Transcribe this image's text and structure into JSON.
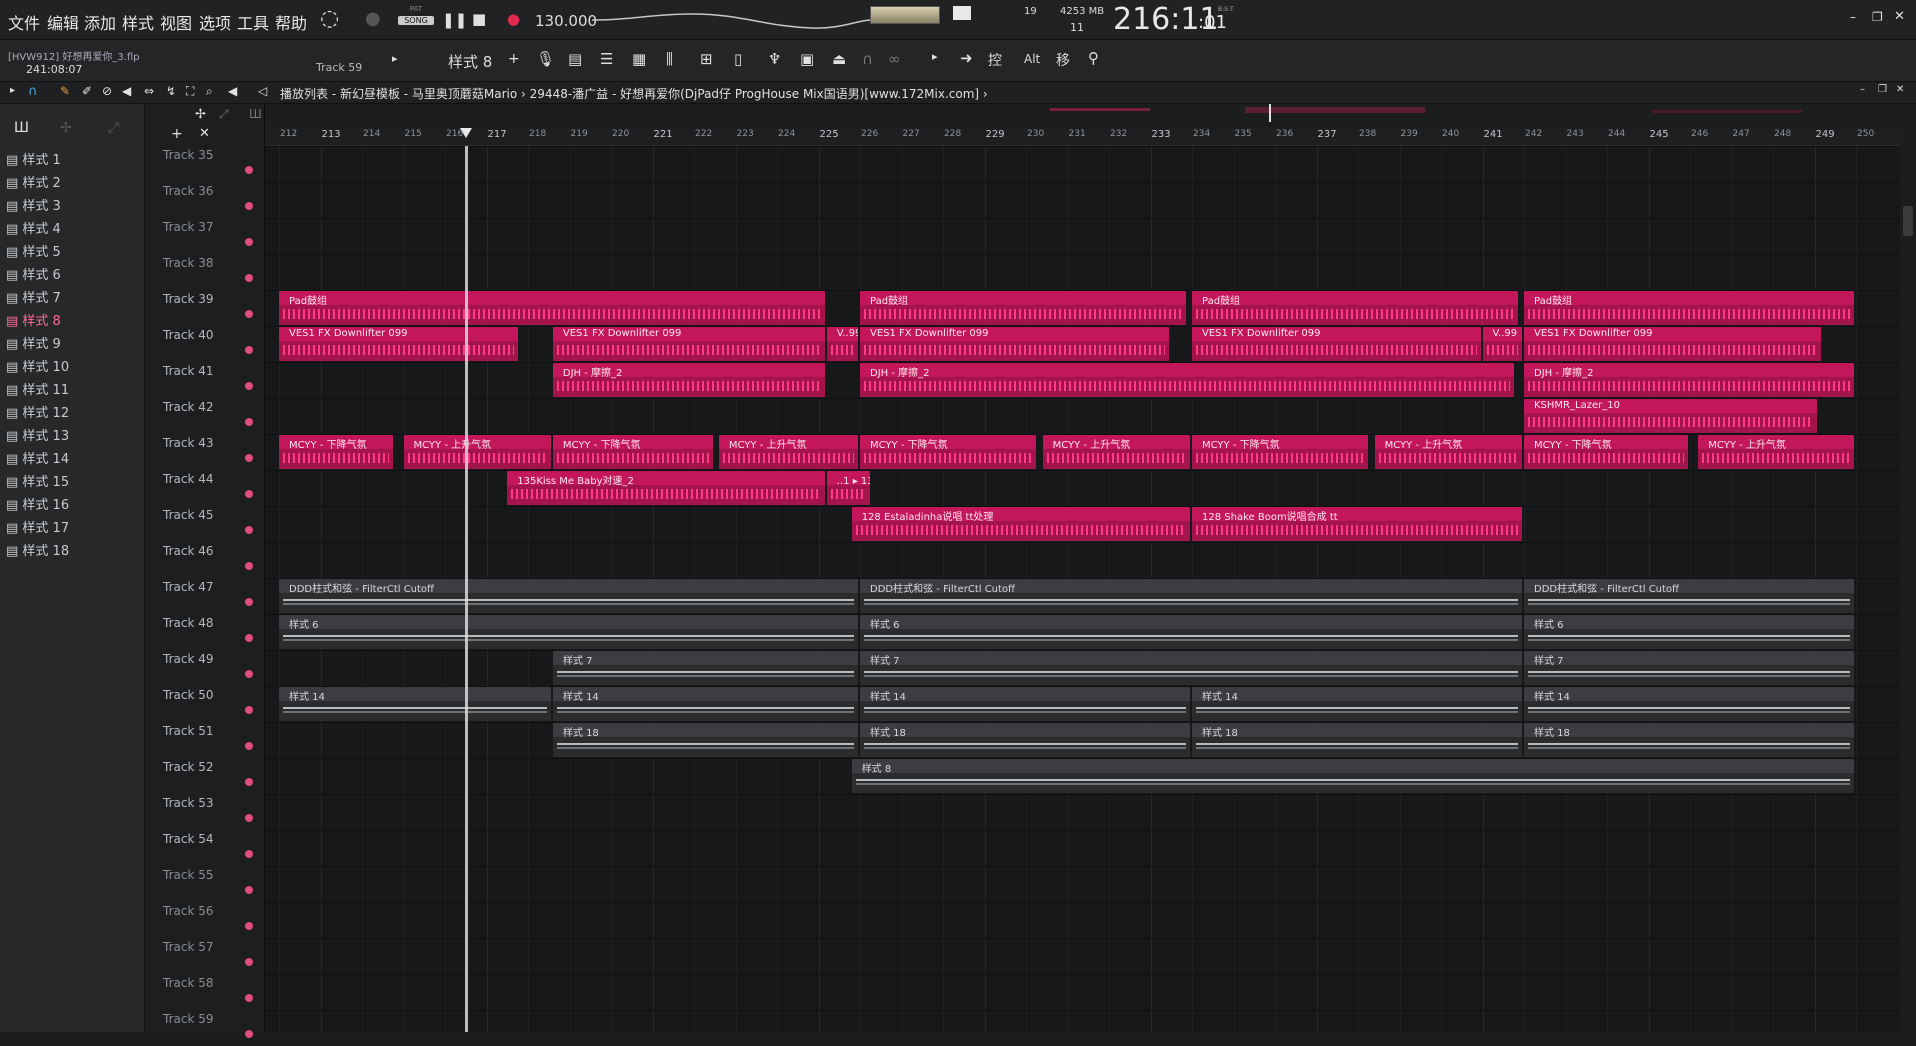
{
  "menu": [
    "文件",
    "编辑",
    "添加",
    "样式",
    "视图",
    "选项",
    "工具",
    "帮助"
  ],
  "transport": {
    "mode_top": "PAT",
    "mode_bottom": "SONG",
    "tempo": "130.000"
  },
  "meters": {
    "cpu": "19",
    "mem": "4253 MB",
    "poly": "11"
  },
  "time": {
    "main": "216:11",
    "sub": ":01",
    "unit": "B:S:T"
  },
  "project": {
    "file": "[HVW912] 好想再爱你_3.flp",
    "pos": "241:08:07"
  },
  "toolbar": {
    "track": "Track 59",
    "pattern": "样式 8",
    "letters": [
      "控",
      "Alt",
      "移"
    ]
  },
  "breadcrumb": "播放列表 - 新幻昼模板 - 马里奥顶蘑菇Mario › 29448-潘广益 - 好想再爱你(DjPad仔 ProgHouse Mix国语男)[www.172Mix.com] ›",
  "patterns": [
    "样式 1",
    "样式 2",
    "样式 3",
    "样式 4",
    "样式 5",
    "样式 6",
    "样式 7",
    "样式 8",
    "样式 9",
    "样式 10",
    "样式 11",
    "样式 12",
    "样式 13",
    "样式 14",
    "样式 15",
    "样式 16",
    "样式 17",
    "样式 18"
  ],
  "tracks": [
    "Track 35",
    "Track 36",
    "Track 37",
    "Track 38",
    "Track 39",
    "Track 40",
    "Track 41",
    "Track 42",
    "Track 43",
    "Track 44",
    "Track 45",
    "Track 46",
    "Track 47",
    "Track 48",
    "Track 49",
    "Track 50",
    "Track 51",
    "Track 52",
    "Track 53",
    "Track 54",
    "Track 55",
    "Track 56",
    "Track 57",
    "Track 58",
    "Track 59"
  ],
  "bars": [
    "212",
    "213",
    "214",
    "215",
    "216",
    "217",
    "218",
    "219",
    "220",
    "221",
    "222",
    "223",
    "224",
    "225",
    "226",
    "227",
    "228",
    "229",
    "230",
    "231",
    "232",
    "233",
    "234",
    "235",
    "236",
    "237",
    "238",
    "239",
    "240",
    "241",
    "242",
    "243",
    "244",
    "245",
    "246",
    "247",
    "248",
    "249",
    "250"
  ],
  "clips": [
    {
      "t": 4,
      "s": 212,
      "e": 225.2,
      "c": "pink",
      "label": "Pad鼓组"
    },
    {
      "t": 4,
      "s": 226,
      "e": 233.9,
      "c": "pink",
      "label": "Pad鼓组"
    },
    {
      "t": 4,
      "s": 234,
      "e": 241.9,
      "c": "pink",
      "label": "Pad鼓组"
    },
    {
      "t": 4,
      "s": 242,
      "e": 250,
      "c": "pink",
      "label": "Pad鼓组"
    },
    {
      "t": 5,
      "s": 212,
      "e": 217.8,
      "c": "pink",
      "label": "VES1 FX Downlifter 099"
    },
    {
      "t": 5,
      "s": 218.6,
      "e": 225.2,
      "c": "pink",
      "label": "VES1 FX Downlifter 099"
    },
    {
      "t": 5,
      "s": 225.2,
      "e": 226,
      "c": "pink",
      "label": "V..99"
    },
    {
      "t": 5,
      "s": 226,
      "e": 233.5,
      "c": "pink",
      "label": "VES1 FX Downlifter 099"
    },
    {
      "t": 5,
      "s": 234,
      "e": 241,
      "c": "pink",
      "label": "VES1 FX Downlifter 099"
    },
    {
      "t": 5,
      "s": 241,
      "e": 242,
      "c": "pink",
      "label": "V..99"
    },
    {
      "t": 5,
      "s": 242,
      "e": 249.2,
      "c": "pink",
      "label": "VES1 FX Downlifter 099"
    },
    {
      "t": 6,
      "s": 218.6,
      "e": 225.2,
      "c": "pink",
      "label": "DJH - 摩擦_2"
    },
    {
      "t": 6,
      "s": 226,
      "e": 241.8,
      "c": "pink",
      "label": "DJH - 摩擦_2"
    },
    {
      "t": 6,
      "s": 242,
      "e": 250,
      "c": "pink",
      "label": "DJH - 摩擦_2"
    },
    {
      "t": 7,
      "s": 242,
      "e": 249.1,
      "c": "pink",
      "label": "KSHMR_Lazer_10"
    },
    {
      "t": 8,
      "s": 212,
      "e": 214.8,
      "c": "pink",
      "label": "MCYY - 下降气氛"
    },
    {
      "t": 8,
      "s": 215,
      "e": 218.6,
      "c": "pink",
      "label": "MCYY - 上升气氛"
    },
    {
      "t": 8,
      "s": 218.6,
      "e": 222.5,
      "c": "pink",
      "label": "MCYY - 下降气氛"
    },
    {
      "t": 8,
      "s": 222.6,
      "e": 226,
      "c": "pink",
      "label": "MCYY - 上升气氛"
    },
    {
      "t": 8,
      "s": 226,
      "e": 230.3,
      "c": "pink",
      "label": "MCYY - 下降气氛"
    },
    {
      "t": 8,
      "s": 230.4,
      "e": 234,
      "c": "pink",
      "label": "MCYY - 上升气氛"
    },
    {
      "t": 8,
      "s": 234,
      "e": 238.3,
      "c": "pink",
      "label": "MCYY - 下降气氛"
    },
    {
      "t": 8,
      "s": 238.4,
      "e": 242,
      "c": "pink",
      "label": "MCYY - 上升气氛"
    },
    {
      "t": 8,
      "s": 242,
      "e": 246,
      "c": "pink",
      "label": "MCYY - 下降气氛"
    },
    {
      "t": 8,
      "s": 246.2,
      "e": 250,
      "c": "pink",
      "label": "MCYY - 上升气氛"
    },
    {
      "t": 9,
      "s": 217.5,
      "e": 225.2,
      "c": "pink",
      "label": "135Kiss Me Baby对速_2"
    },
    {
      "t": 9,
      "s": 225.2,
      "e": 226.3,
      "c": "pink",
      "label": "..1 ▸ 13..速_2"
    },
    {
      "t": 10,
      "s": 225.8,
      "e": 234,
      "c": "pink",
      "label": "128 Estaladinha说唱 tt处理"
    },
    {
      "t": 10,
      "s": 234,
      "e": 242,
      "c": "pink",
      "label": "128 Shake Boom说唱合成 tt"
    },
    {
      "t": 12,
      "s": 212,
      "e": 226,
      "c": "gray",
      "label": "DDD柱式和弦 - FilterCtl Cutoff"
    },
    {
      "t": 12,
      "s": 226,
      "e": 242,
      "c": "gray",
      "label": "DDD柱式和弦 - FilterCtl Cutoff"
    },
    {
      "t": 12,
      "s": 242,
      "e": 250,
      "c": "gray",
      "label": "DDD柱式和弦 - FilterCtl Cutoff"
    },
    {
      "t": 13,
      "s": 212,
      "e": 226,
      "c": "gray",
      "label": "样式 6"
    },
    {
      "t": 13,
      "s": 226,
      "e": 242,
      "c": "gray",
      "label": "样式 6"
    },
    {
      "t": 13,
      "s": 242,
      "e": 250,
      "c": "gray",
      "label": "样式 6"
    },
    {
      "t": 14,
      "s": 218.6,
      "e": 226,
      "c": "gray",
      "label": "样式 7"
    },
    {
      "t": 14,
      "s": 226,
      "e": 242,
      "c": "gray",
      "label": "样式 7"
    },
    {
      "t": 14,
      "s": 242,
      "e": 250,
      "c": "gray",
      "label": "样式 7"
    },
    {
      "t": 15,
      "s": 212,
      "e": 218.6,
      "c": "gray",
      "label": "样式 14"
    },
    {
      "t": 15,
      "s": 218.6,
      "e": 226,
      "c": "gray",
      "label": "样式 14"
    },
    {
      "t": 15,
      "s": 226,
      "e": 234,
      "c": "gray",
      "label": "样式 14"
    },
    {
      "t": 15,
      "s": 234,
      "e": 242,
      "c": "gray",
      "label": "样式 14"
    },
    {
      "t": 15,
      "s": 242,
      "e": 250,
      "c": "gray",
      "label": "样式 14"
    },
    {
      "t": 16,
      "s": 218.6,
      "e": 226,
      "c": "gray",
      "label": "样式 18"
    },
    {
      "t": 16,
      "s": 226,
      "e": 234,
      "c": "gray",
      "label": "样式 18"
    },
    {
      "t": 16,
      "s": 234,
      "e": 242,
      "c": "gray",
      "label": "样式 18"
    },
    {
      "t": 16,
      "s": 242,
      "e": 250,
      "c": "gray",
      "label": "样式 18"
    },
    {
      "t": 17,
      "s": 225.8,
      "e": 250,
      "c": "gray",
      "label": "样式 8"
    }
  ],
  "playhead_bar": 216.5,
  "colors": {
    "accent": "#e0226d",
    "clip_pink": "#c4175b",
    "clip_gray": "#3b3d40",
    "bg": "#161819"
  }
}
